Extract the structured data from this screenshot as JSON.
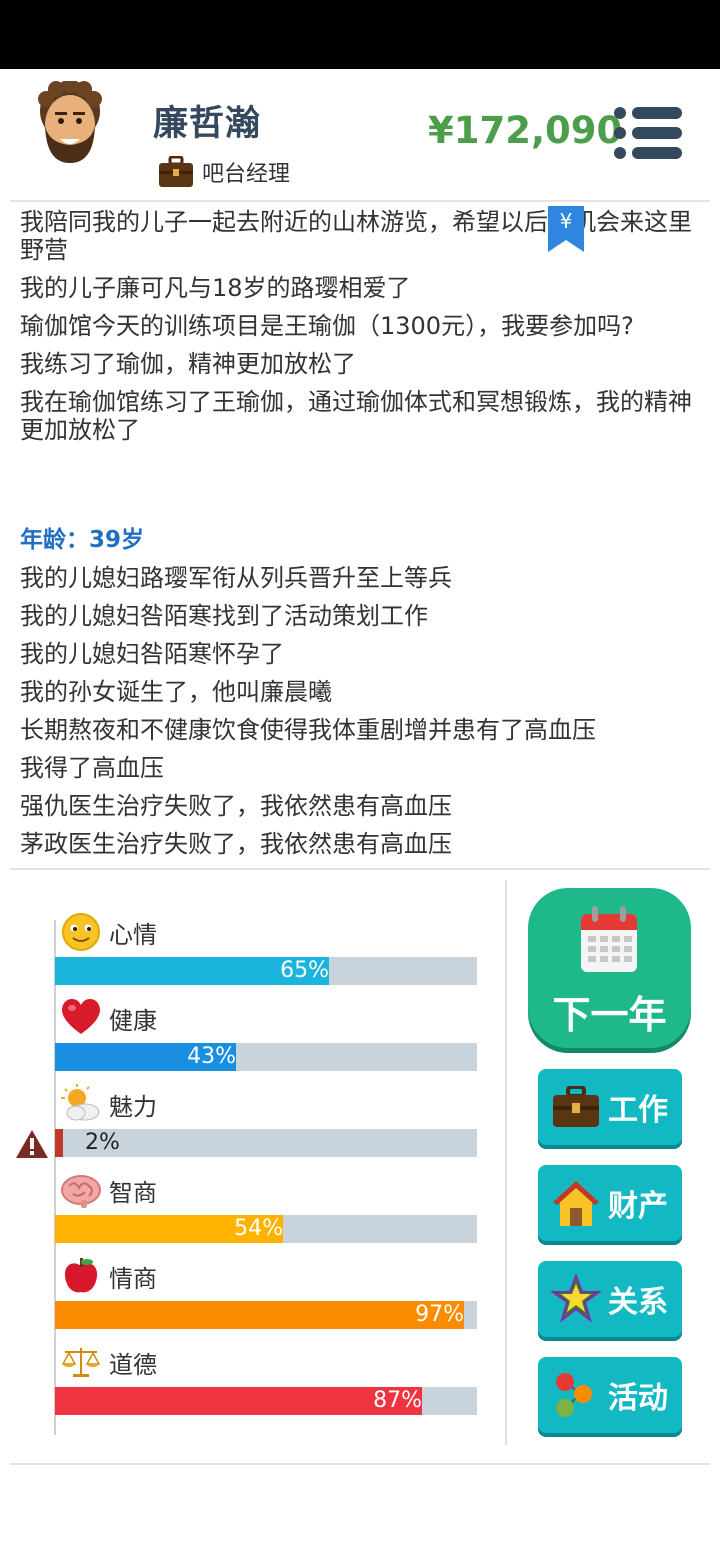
{
  "header": {
    "name": "廉哲瀚",
    "job_title": "吧台经理",
    "money": "¥172,090"
  },
  "bookmark": {
    "label": "¥"
  },
  "log": {
    "lines_before": [
      "我陪同我的儿子一起去附近的山林游览，希望以后有机会来这里野营",
      "我的儿子廉可凡与18岁的路璎相爱了",
      "瑜伽馆今天的训练项目是王瑜伽（1300元），我要参加吗?",
      "我练习了瑜伽，精神更加放松了",
      "我在瑜伽馆练习了王瑜伽，通过瑜伽体式和冥想锻炼，我的精神更加放松了"
    ],
    "age_label": "年龄：39岁",
    "lines_after": [
      "我的儿媳妇路璎军衔从列兵晋升至上等兵",
      "我的儿媳妇咎陌寒找到了活动策划工作",
      "我的儿媳妇咎陌寒怀孕了",
      "我的孙女诞生了，他叫廉晨曦",
      "长期熬夜和不健康饮食使得我体重剧增并患有了高血压",
      "我得了高血压",
      "强仇医生治疗失败了，我依然患有高血压",
      "茅政医生治疗失败了，我依然患有高血压"
    ]
  },
  "stats": [
    {
      "label": "心情",
      "percent": 65,
      "text": "65%",
      "color": "#1bb4dc",
      "icon": "smiley-icon"
    },
    {
      "label": "健康",
      "percent": 43,
      "text": "43%",
      "color": "#1a8ee0",
      "icon": "heart-icon"
    },
    {
      "label": "魅力",
      "percent": 2,
      "text": "2%",
      "color": "#c0392b",
      "icon": "sun-cloud-icon",
      "warning": true
    },
    {
      "label": "智商",
      "percent": 54,
      "text": "54%",
      "color": "#ffb300",
      "icon": "brain-icon"
    },
    {
      "label": "情商",
      "percent": 97,
      "text": "97%",
      "color": "#fb8c00",
      "icon": "apple-icon"
    },
    {
      "label": "道德",
      "percent": 87,
      "text": "87%",
      "color": "#ef3340",
      "icon": "scales-icon"
    }
  ],
  "actions": {
    "next_year": "下一年",
    "work": "工作",
    "assets": "财产",
    "relations": "关系",
    "activities": "活动"
  }
}
